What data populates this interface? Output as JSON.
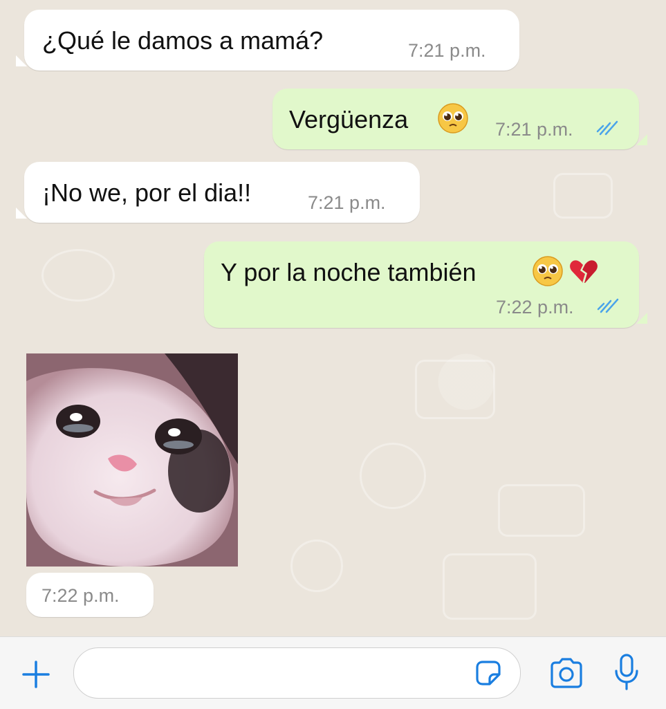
{
  "messages": [
    {
      "direction": "in",
      "text": "¿Qué le damos a mamá?",
      "time": "7:21 p.m."
    },
    {
      "direction": "out",
      "text": "Vergüenza",
      "emoji": "pleading-face",
      "time": "7:21 p.m.",
      "status": "read"
    },
    {
      "direction": "in",
      "text": "¡No we, por el dia!!",
      "time": "7:21 p.m."
    },
    {
      "direction": "out",
      "text": "Y por la noche también",
      "emoji": "pleading-face broken-heart",
      "time": "7:22 p.m.",
      "status": "read"
    },
    {
      "direction": "in",
      "type": "image",
      "image": "crying-cat-meme",
      "time": "7:22 p.m."
    }
  ],
  "input_bar": {
    "icons": [
      "plus-icon",
      "sticker-icon",
      "camera-icon",
      "microphone-icon"
    ],
    "accent_color": "#1a7ee0"
  },
  "colors": {
    "incoming_bubble": "#ffffff",
    "outgoing_bubble": "#e1f8cb",
    "read_ticks": "#4aa3ea"
  }
}
